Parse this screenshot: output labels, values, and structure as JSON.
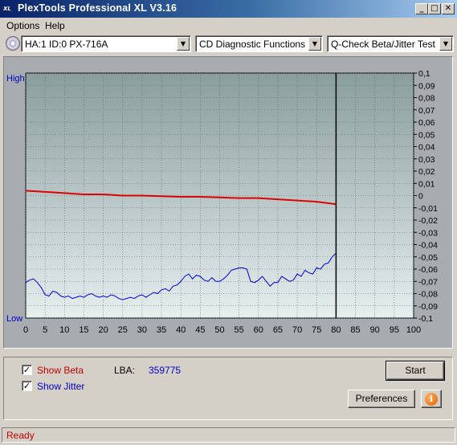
{
  "window": {
    "title": "PlexTools Professional XL V3.16",
    "icon_text": "XL",
    "controls": {
      "minimize": "_",
      "maximize": "□",
      "close": "✕"
    }
  },
  "menu": [
    "Options",
    "Help"
  ],
  "toolbar": {
    "drive": "HA:1 ID:0  PX-716A",
    "function": "CD Diagnostic Functions",
    "test": "Q-Check Beta/Jitter Test"
  },
  "chart_data": {
    "type": "line",
    "x_ticks": [
      "0",
      "5",
      "10",
      "15",
      "20",
      "25",
      "30",
      "35",
      "40",
      "45",
      "50",
      "55",
      "60",
      "65",
      "70",
      "75",
      "80",
      "85",
      "90",
      "95",
      "100"
    ],
    "xlim": [
      0,
      100
    ],
    "y_left_labels": {
      "top": "High",
      "bottom": "Low"
    },
    "y_right_ticks": [
      "0,1",
      "0,09",
      "0,08",
      "0,07",
      "0,06",
      "0,05",
      "0,04",
      "0,03",
      "0,02",
      "0,01",
      "0",
      "-0,01",
      "-0,02",
      "-0,03",
      "-0,04",
      "-0,05",
      "-0,06",
      "-0,07",
      "-0,08",
      "-0,09",
      "-0,1"
    ],
    "ylim": [
      -0.1,
      0.1
    ],
    "marker_x": 80,
    "series": [
      {
        "color": "#e00000",
        "x": [
          0,
          5,
          10,
          15,
          20,
          25,
          30,
          35,
          40,
          45,
          50,
          55,
          60,
          65,
          70,
          75,
          80
        ],
        "values": [
          0.004,
          0.003,
          0.002,
          0.001,
          0.001,
          0.0,
          0.0,
          -0.0005,
          -0.001,
          -0.001,
          -0.0015,
          -0.002,
          -0.002,
          -0.003,
          -0.004,
          -0.005,
          -0.007
        ]
      },
      {
        "color": "#0000e0",
        "x": [
          0,
          1,
          2,
          3,
          4,
          5,
          6,
          7,
          8,
          9,
          10,
          11,
          12,
          13,
          14,
          15,
          16,
          17,
          18,
          19,
          20,
          21,
          22,
          23,
          24,
          25,
          26,
          27,
          28,
          29,
          30,
          31,
          32,
          33,
          34,
          35,
          36,
          37,
          38,
          39,
          40,
          41,
          42,
          43,
          44,
          45,
          46,
          47,
          48,
          49,
          50,
          51,
          52,
          53,
          54,
          55,
          56,
          57,
          58,
          59,
          60,
          61,
          62,
          63,
          64,
          65,
          66,
          67,
          68,
          69,
          70,
          71,
          72,
          73,
          74,
          75,
          76,
          77,
          78,
          79,
          80
        ],
        "values": [
          -0.071,
          -0.069,
          -0.068,
          -0.071,
          -0.075,
          -0.081,
          -0.082,
          -0.078,
          -0.079,
          -0.082,
          -0.083,
          -0.082,
          -0.084,
          -0.083,
          -0.082,
          -0.083,
          -0.081,
          -0.08,
          -0.082,
          -0.083,
          -0.082,
          -0.083,
          -0.081,
          -0.082,
          -0.084,
          -0.085,
          -0.084,
          -0.083,
          -0.084,
          -0.082,
          -0.081,
          -0.083,
          -0.081,
          -0.079,
          -0.08,
          -0.077,
          -0.076,
          -0.078,
          -0.074,
          -0.073,
          -0.07,
          -0.066,
          -0.064,
          -0.068,
          -0.065,
          -0.066,
          -0.069,
          -0.07,
          -0.067,
          -0.07,
          -0.07,
          -0.068,
          -0.065,
          -0.061,
          -0.06,
          -0.059,
          -0.059,
          -0.06,
          -0.07,
          -0.071,
          -0.069,
          -0.066,
          -0.07,
          -0.074,
          -0.071,
          -0.071,
          -0.066,
          -0.068,
          -0.07,
          -0.069,
          -0.064,
          -0.066,
          -0.061,
          -0.063,
          -0.064,
          -0.059,
          -0.06,
          -0.056,
          -0.055,
          -0.05,
          -0.047
        ]
      }
    ]
  },
  "panel": {
    "show_beta": {
      "label": "Show Beta",
      "checked": true,
      "check_glyph": "✓"
    },
    "show_jitter": {
      "label": "Show Jitter",
      "checked": true,
      "check_glyph": "✓"
    },
    "lba_label": "LBA:",
    "lba_value": "359775",
    "start_label": "Start",
    "preferences_label": "Preferences",
    "info_glyph": "i"
  },
  "status": {
    "text": "Ready"
  },
  "colors": {
    "beta": "#e00000",
    "jitter": "#0000e0",
    "status": "#c00000",
    "lba_value": "#0000c0"
  }
}
